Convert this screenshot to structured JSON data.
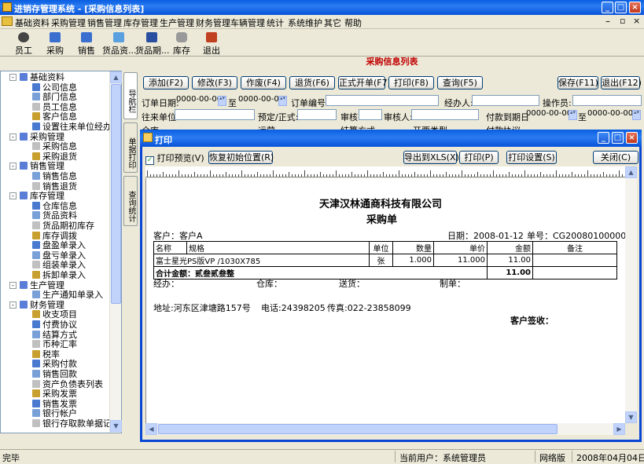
{
  "window": {
    "title": "进销存管理系统 - [采购信息列表]",
    "min": "_",
    "max": "□",
    "close": "×"
  },
  "menu": [
    "基础资料",
    "采购管理",
    "销售管理",
    "库存管理",
    "生产管理",
    "财务管理",
    "车辆管理",
    "统计",
    "系统维护",
    "其它",
    "帮助"
  ],
  "toolbar": [
    "员工",
    "采购",
    "销售",
    "货品资...",
    "货品期...",
    "库存",
    "退出"
  ],
  "tree": [
    {
      "label": "基础资料",
      "level": 0,
      "exp": "-"
    },
    {
      "label": "公司信息",
      "level": 1
    },
    {
      "label": "部门信息",
      "level": 1
    },
    {
      "label": "员工信息",
      "level": 1
    },
    {
      "label": "客户信息",
      "level": 1
    },
    {
      "label": "设置往来单位经办人",
      "level": 1
    },
    {
      "label": "采购管理",
      "level": 0,
      "exp": "-"
    },
    {
      "label": "采购信息",
      "level": 1
    },
    {
      "label": "采购退货",
      "level": 1
    },
    {
      "label": "销售管理",
      "level": 0,
      "exp": "-"
    },
    {
      "label": "销售信息",
      "level": 1
    },
    {
      "label": "销售退货",
      "level": 1
    },
    {
      "label": "库存管理",
      "level": 0,
      "exp": "-"
    },
    {
      "label": "仓库信息",
      "level": 1
    },
    {
      "label": "货品资料",
      "level": 1
    },
    {
      "label": "货品期初库存",
      "level": 1
    },
    {
      "label": "库存调拨",
      "level": 1
    },
    {
      "label": "盘盈单录入",
      "level": 1
    },
    {
      "label": "盘亏单录入",
      "level": 1
    },
    {
      "label": "组装单录入",
      "level": 1
    },
    {
      "label": "拆卸单录入",
      "level": 1
    },
    {
      "label": "生产管理",
      "level": 0,
      "exp": "-"
    },
    {
      "label": "生产通知单录入",
      "level": 1
    },
    {
      "label": "财务管理",
      "level": 0,
      "exp": "-"
    },
    {
      "label": "收支项目",
      "level": 1
    },
    {
      "label": "付费协议",
      "level": 1
    },
    {
      "label": "结算方式",
      "level": 1
    },
    {
      "label": "币种汇率",
      "level": 1
    },
    {
      "label": "税率",
      "level": 1
    },
    {
      "label": "采购付款",
      "level": 1
    },
    {
      "label": "销售回款",
      "level": 1
    },
    {
      "label": "资产负债表列表",
      "level": 1
    },
    {
      "label": "采购发票",
      "level": 1
    },
    {
      "label": "销售发票",
      "level": 1
    },
    {
      "label": "银行帐户",
      "level": 1
    },
    {
      "label": "银行存取款单据记录",
      "level": 1
    }
  ],
  "sidetabs": [
    "导航栏",
    "单据打印",
    "查询统计"
  ],
  "list": {
    "title": "采购信息列表",
    "buttons": [
      "添加(F2)",
      "修改(F3)",
      "作废(F4)",
      "退货(F6)",
      "正式开单(F7)",
      "打印(F8)",
      "查询(F5)"
    ],
    "right_buttons": [
      "保存(F11)",
      "退出(F12)"
    ],
    "row1": {
      "date_label": "订单日期:",
      "date_from": "0000-00-00",
      "to": "至",
      "date_to": "0000-00-00",
      "orderno": "订单编号",
      "handler": "经办人:",
      "operator": "操作员:"
    },
    "row2": {
      "unit": "往来单位:",
      "formal": "预定/正式:",
      "audit": "审核:",
      "auditor": "审核人:",
      "due": "付款到期日",
      "due_from": "0000-00-00",
      "to": "至",
      "due_to": "0000-00-00"
    },
    "row3_partial": [
      "仓库",
      "运营",
      "结算方式",
      "开票类型",
      "付款协议"
    ]
  },
  "dialog": {
    "title": "打印",
    "preview_check": "打印预览(V)",
    "reset": "恢复初始位置(R)",
    "export": "导出到XLS(X)",
    "print": "打印(P)",
    "settings": "打印设置(S)",
    "close": "关闭(C)",
    "doc": {
      "company": "天津汉林通商科技有限公司",
      "title": "采购单",
      "customer": "客户：客户A",
      "date": "日期：2008-01-12",
      "no": "单号：CG200801000001",
      "headers": [
        "名称",
        "规格",
        "单位",
        "数量",
        "单价",
        "金额",
        "备注"
      ],
      "rows": [
        [
          "富士星光PS版VP",
          "/1030X785",
          "张",
          "1.000",
          "11.000",
          "11.00",
          ""
        ]
      ],
      "total_label": "合计金额：",
      "total_text": "贰叁贰叁整",
      "total": "11.00",
      "sign": [
        "经办：",
        "仓库：",
        "送货：",
        "制单："
      ],
      "address": "地址:河东区津塘路157号",
      "phone": "电话:24398205",
      "fax": "传真:022-23858099",
      "cust_sign": "客户签收："
    }
  },
  "status": {
    "left": "完毕",
    "user": "当前用户：系统管理员",
    "edition": "网络版",
    "date": "2008年04月04日"
  }
}
